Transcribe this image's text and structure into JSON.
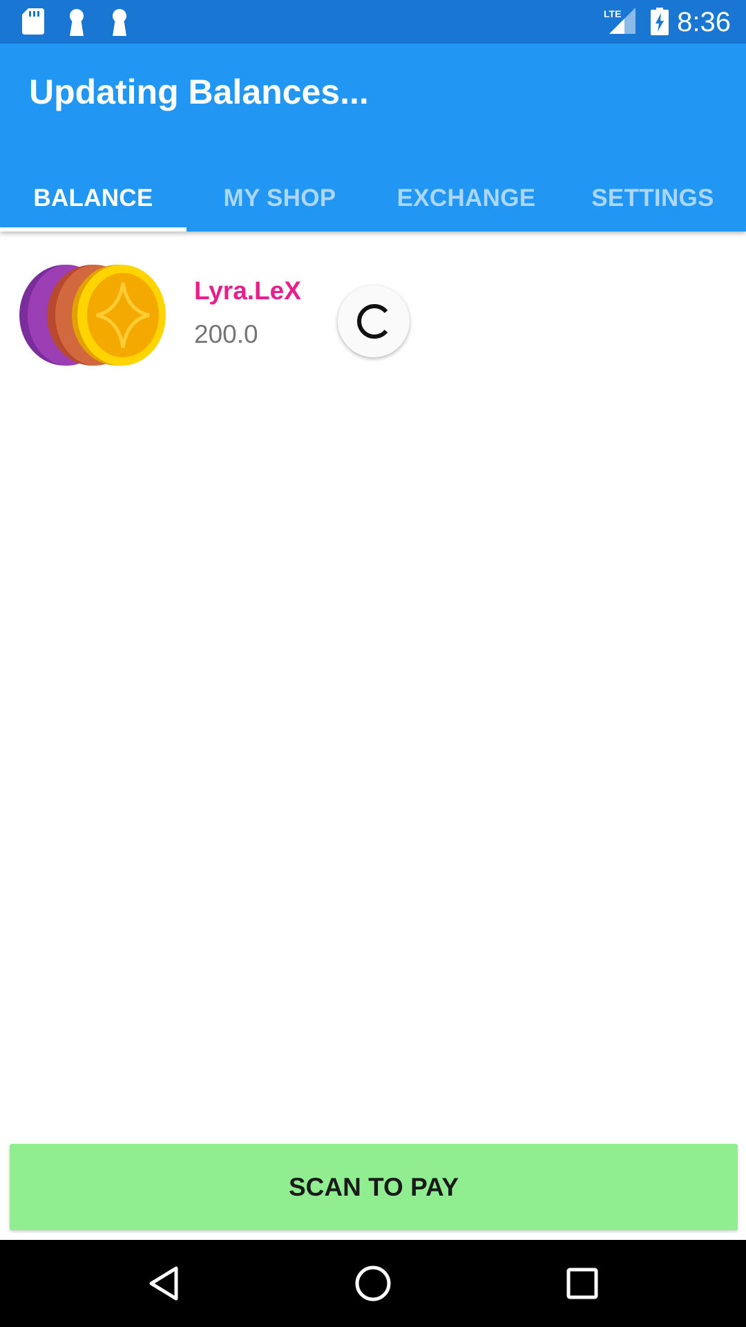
{
  "status_bar": {
    "time": "8:36",
    "left_icons": [
      "sd-card-icon",
      "keyhole-icon",
      "keyhole-icon"
    ],
    "right_icons": [
      "lte-signal-icon",
      "battery-charging-icon"
    ],
    "network_label": "LTE",
    "background": "#1976D2"
  },
  "app_bar": {
    "title": "Updating Balances...",
    "background": "#2196F3",
    "tabs": [
      {
        "label": "BALANCE",
        "active": true
      },
      {
        "label": "MY SHOP",
        "active": false
      },
      {
        "label": "EXCHANGE",
        "active": false
      },
      {
        "label": "SETTINGS",
        "active": false
      }
    ]
  },
  "balance": {
    "items": [
      {
        "icon": "coin-stack-icon",
        "name": "Lyra.LeX",
        "amount": "200.0",
        "name_color": "#E91E8C"
      }
    ],
    "loading_icon": "loading-spinner-icon"
  },
  "scan_button": {
    "label": "SCAN TO PAY",
    "background": "#90EE90"
  },
  "nav_bar": {
    "buttons": [
      "back-icon",
      "home-icon",
      "recents-icon"
    ]
  }
}
